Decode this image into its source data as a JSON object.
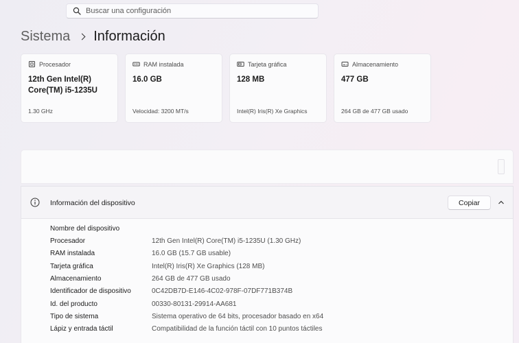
{
  "search": {
    "placeholder": "Buscar una configuración"
  },
  "breadcrumb": {
    "parent": "Sistema",
    "current": "Información"
  },
  "cards": [
    {
      "title": "Procesador",
      "icon": "cpu-icon",
      "value": "12th Gen Intel(R) Core(TM) i5-1235U",
      "sub": "1.30 GHz"
    },
    {
      "title": "RAM instalada",
      "icon": "ram-icon",
      "value": "16.0 GB",
      "sub": "Velocidad: 3200 MT/s"
    },
    {
      "title": "Tarjeta gráfica",
      "icon": "gpu-icon",
      "value": "128 MB",
      "sub": "Intel(R) Iris(R) Xe Graphics"
    },
    {
      "title": "Almacenamiento",
      "icon": "storage-icon",
      "value": "477 GB",
      "sub": "264 GB de 477 GB usado"
    }
  ],
  "device": {
    "title": "Información del dispositivo",
    "copy_label": "Copiar",
    "info_icon": "info-icon",
    "collapse_icon": "chevron-up-icon",
    "rows": [
      {
        "label": "Nombre del dispositivo",
        "value": ""
      },
      {
        "label": "Procesador",
        "value": "12th Gen Intel(R) Core(TM) i5-1235U (1.30 GHz)"
      },
      {
        "label": "RAM instalada",
        "value": "16.0 GB (15.7 GB usable)"
      },
      {
        "label": "Tarjeta gráfica",
        "value": "Intel(R) Iris(R) Xe Graphics (128 MB)"
      },
      {
        "label": "Almacenamiento",
        "value": "264 GB de 477 GB usado"
      },
      {
        "label": "Identificador de dispositivo",
        "value": "0C42DB7D-E146-4C02-978F-07DF771B374B"
      },
      {
        "label": "Id. del producto",
        "value": "00330-80131-29914-AA681"
      },
      {
        "label": "Tipo de sistema",
        "value": "Sistema operativo de 64 bits, procesador basado en x64"
      },
      {
        "label": "Lápiz y entrada táctil",
        "value": "Compatibilidad de la función táctil con 10 puntos táctiles"
      }
    ]
  }
}
